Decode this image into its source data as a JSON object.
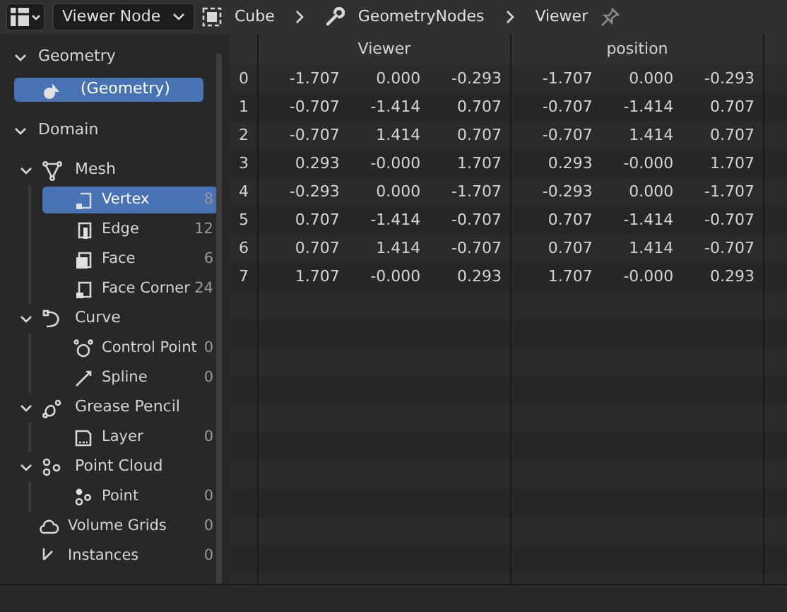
{
  "header": {
    "viewer_dropdown": "Viewer Node",
    "breadcrumbs": [
      {
        "kind": "object",
        "label": "Cube"
      },
      {
        "kind": "modifier",
        "label": "GeometryNodes"
      },
      {
        "kind": "node",
        "label": "Viewer"
      }
    ]
  },
  "sidebar": {
    "geometry": {
      "title": "Geometry",
      "expanded": true,
      "items": [
        {
          "label": "(Geometry)",
          "selected": true
        }
      ]
    },
    "domain": {
      "title": "Domain",
      "expanded": true,
      "items": [
        {
          "kind": "mesh",
          "label": "Mesh",
          "expanded": true,
          "children": [
            {
              "kind": "vertex",
              "label": "Vertex",
              "count": "8",
              "selected": true
            },
            {
              "kind": "edge",
              "label": "Edge",
              "count": "12",
              "selected": false
            },
            {
              "kind": "face",
              "label": "Face",
              "count": "6",
              "selected": false
            },
            {
              "kind": "face_corner",
              "label": "Face Corner",
              "count": "24",
              "selected": false
            }
          ]
        },
        {
          "kind": "curve",
          "label": "Curve",
          "expanded": true,
          "children": [
            {
              "kind": "control_point",
              "label": "Control Point",
              "count": "0",
              "selected": false
            },
            {
              "kind": "spline",
              "label": "Spline",
              "count": "0",
              "selected": false
            }
          ]
        },
        {
          "kind": "grease_pencil",
          "label": "Grease Pencil",
          "expanded": true,
          "children": [
            {
              "kind": "layer",
              "label": "Layer",
              "count": "0",
              "selected": false
            }
          ]
        },
        {
          "kind": "point_cloud",
          "label": "Point Cloud",
          "expanded": true,
          "children": [
            {
              "kind": "point",
              "label": "Point",
              "count": "0",
              "selected": false
            }
          ]
        },
        {
          "kind": "volume_grids",
          "label": "Volume Grids",
          "count": "0",
          "selected": false
        },
        {
          "kind": "instances",
          "label": "Instances",
          "count": "0",
          "selected": false
        }
      ]
    }
  },
  "table": {
    "column_groups": [
      {
        "label": "Viewer"
      },
      {
        "label": "position"
      }
    ],
    "rows": [
      {
        "index": "0",
        "cells": [
          "-1.707",
          "0.000",
          "-0.293",
          "-1.707",
          "0.000",
          "-0.293"
        ]
      },
      {
        "index": "1",
        "cells": [
          "-0.707",
          "-1.414",
          "0.707",
          "-0.707",
          "-1.414",
          "0.707"
        ]
      },
      {
        "index": "2",
        "cells": [
          "-0.707",
          "1.414",
          "0.707",
          "-0.707",
          "1.414",
          "0.707"
        ]
      },
      {
        "index": "3",
        "cells": [
          "0.293",
          "-0.000",
          "1.707",
          "0.293",
          "-0.000",
          "1.707"
        ]
      },
      {
        "index": "4",
        "cells": [
          "-0.293",
          "0.000",
          "-1.707",
          "-0.293",
          "0.000",
          "-1.707"
        ]
      },
      {
        "index": "5",
        "cells": [
          "0.707",
          "-1.414",
          "-0.707",
          "0.707",
          "-1.414",
          "-0.707"
        ]
      },
      {
        "index": "6",
        "cells": [
          "0.707",
          "1.414",
          "-0.707",
          "0.707",
          "1.414",
          "-0.707"
        ]
      },
      {
        "index": "7",
        "cells": [
          "1.707",
          "-0.000",
          "0.293",
          "1.707",
          "-0.000",
          "0.293"
        ]
      }
    ]
  }
}
